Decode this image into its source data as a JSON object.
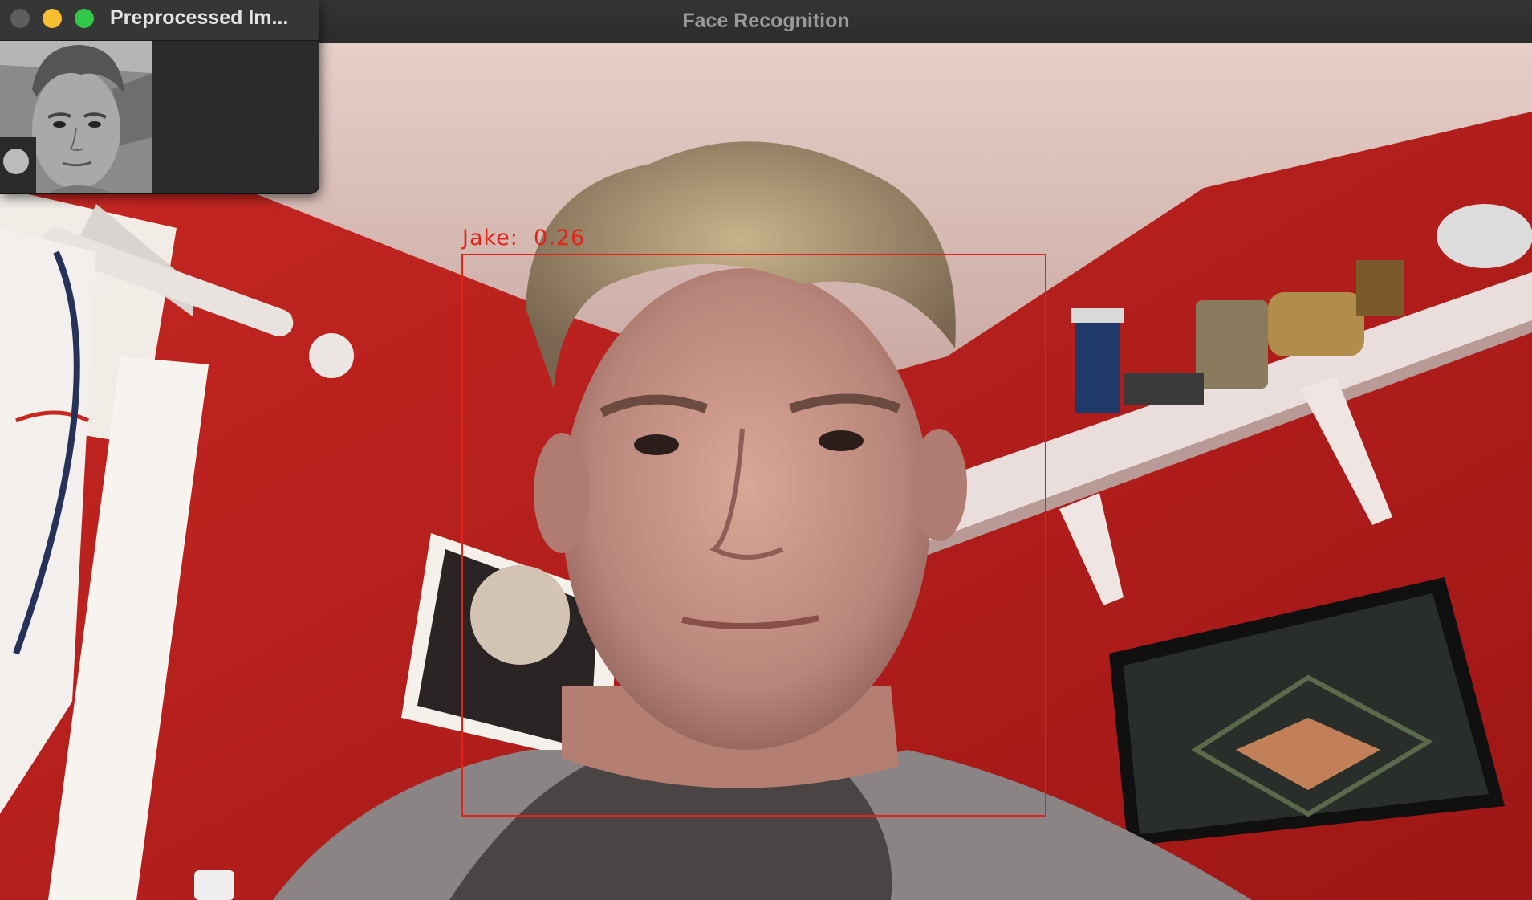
{
  "app": {
    "main_window_title": "Face Recognition",
    "preview_window_title": "Preprocessed Im..."
  },
  "detection": {
    "name": "Jake",
    "score": "0.26",
    "label": "Jake:  0.26",
    "box_color": "#e2231a"
  },
  "preview_window": {
    "buttons": {
      "close": "close-button",
      "minimize": "minimize-button",
      "zoom": "zoom-button"
    },
    "image": "grayscale-face-crop"
  },
  "colors": {
    "titlebar_bg": "#2f2f2f",
    "title_text": "#9a9a9a",
    "wall_red": "#b61e1c",
    "ceiling": "#d9bdb6",
    "traffic_close_inactive": "#5e5e5e",
    "traffic_minimize": "#f7be2f",
    "traffic_zoom": "#32c748"
  }
}
